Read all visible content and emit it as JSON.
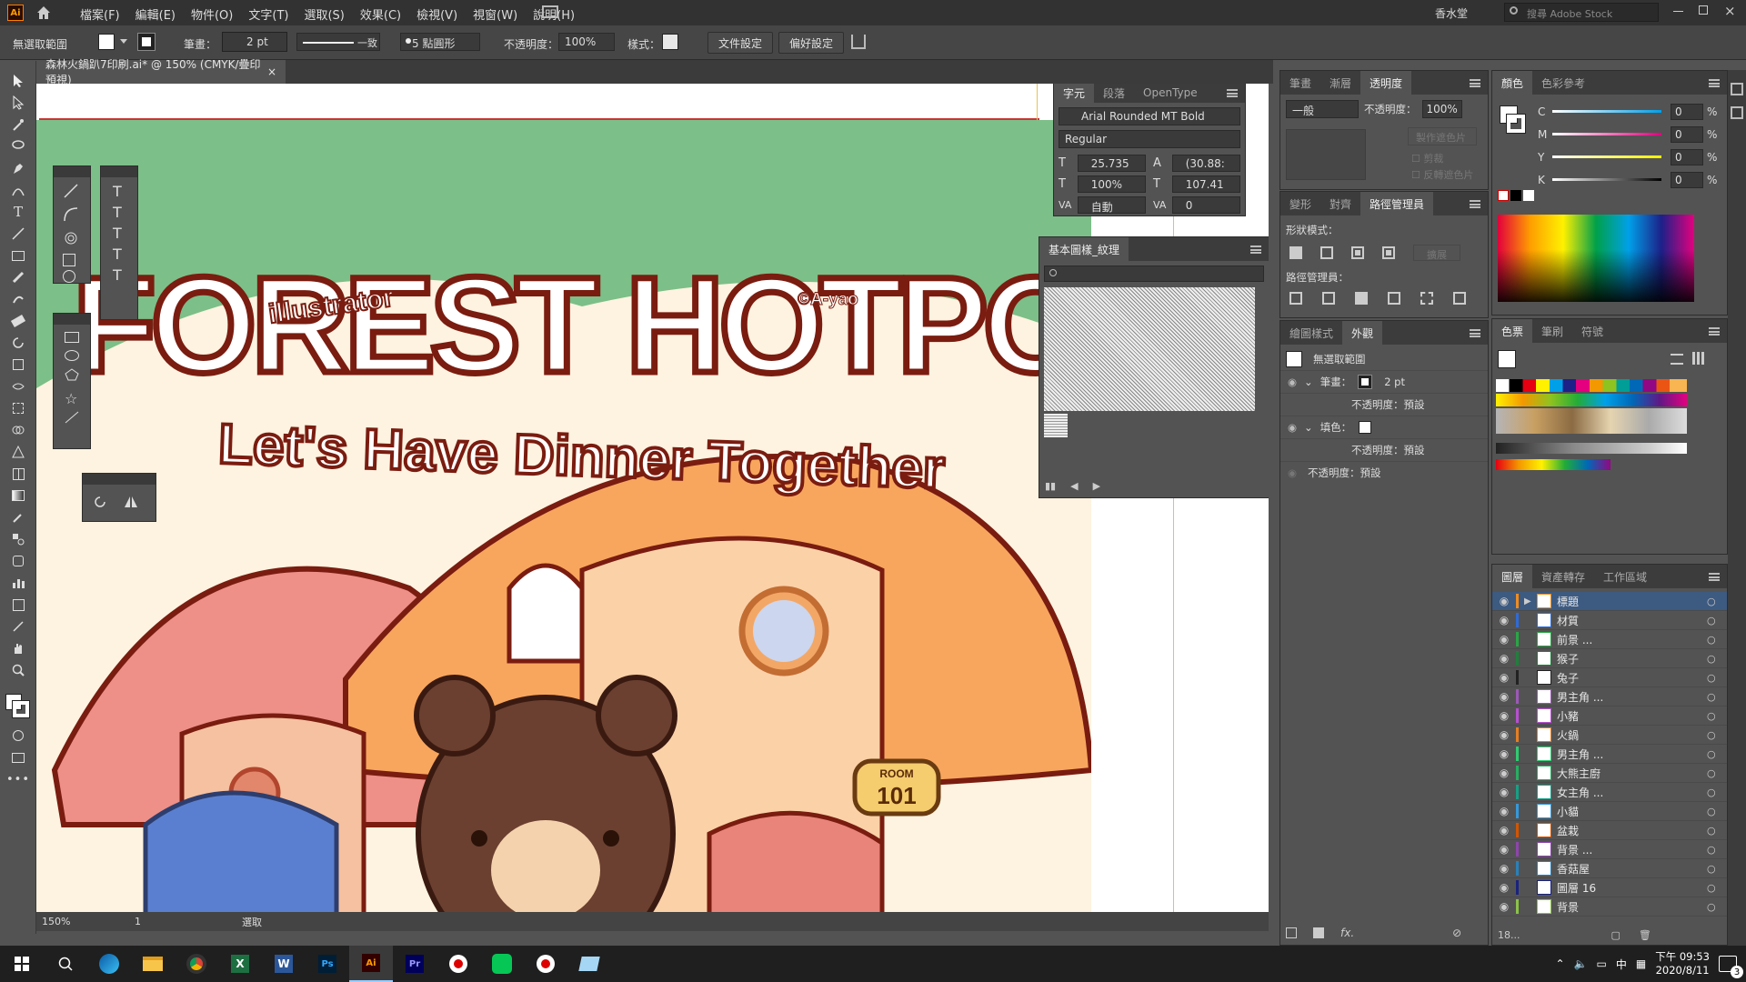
{
  "app": {
    "logo_text": "Ai"
  },
  "menus": [
    "檔案(F)",
    "編輯(E)",
    "物件(O)",
    "文字(T)",
    "選取(S)",
    "效果(C)",
    "檢視(V)",
    "視窗(W)",
    "說明(H)"
  ],
  "workspace": "香水堂",
  "stock_search": {
    "placeholder": "搜尋 Adobe Stock"
  },
  "control": {
    "selection_label": "無選取範圍",
    "stroke_label": "筆畫：",
    "stroke_value": "2 pt",
    "profile_label": "一致",
    "brush_label": "5 點圓形",
    "opacity_label": "不透明度：",
    "opacity_value": "100%",
    "style_label": "樣式：",
    "doc_setup_btn": "文件設定",
    "prefs_btn": "偏好設定"
  },
  "document_tab": {
    "title": "森林火鍋趴7印刷.ai* @ 150% (CMYK/疊印預視)"
  },
  "artwork": {
    "title_line": "FOREST HOTPOT",
    "subtitle": "Let's Have Dinner Together",
    "tag_illustrator": "illustrator",
    "credit": "©A-yao",
    "sign_room": "ROOM",
    "sign_number": "101"
  },
  "character_panel": {
    "tabs": [
      "字元",
      "段落",
      "OpenType"
    ],
    "font_family": "Arial Rounded MT Bold",
    "font_style": "Regular",
    "font_size": "25.735",
    "leading": "(30.88:",
    "vert_scale": "100%",
    "horiz_scale": "107.41",
    "kerning": "自動",
    "tracking": "0"
  },
  "swatch_lib_panel": {
    "title": "基本圖樣_紋理"
  },
  "transparency_panel": {
    "tabs": [
      "筆畫",
      "漸層",
      "透明度"
    ],
    "mode": "一般",
    "opacity_label": "不透明度：",
    "opacity_value": "100%",
    "make_mask_btn": "製作遮色片",
    "clip_label": "剪裁",
    "invert_label": "反轉遮色片"
  },
  "pathfinder_panel": {
    "tabs": [
      "變形",
      "對齊",
      "路徑管理員"
    ],
    "shape_modes_label": "形狀模式：",
    "expand_btn": "擴展",
    "pathfinders_label": "路徑管理員："
  },
  "appearance_panel": {
    "tabs": [
      "繪圖樣式",
      "外觀"
    ],
    "header": "無選取範圍",
    "stroke_label": "筆畫：",
    "stroke_value": "2 pt",
    "opacity_default_1": "不透明度：預設",
    "fill_label": "填色：",
    "opacity_default_2": "不透明度：預設",
    "opacity_default_3": "不透明度：預設"
  },
  "color_panel": {
    "tabs": [
      "顏色",
      "色彩參考"
    ],
    "channels": [
      {
        "name": "C",
        "value": "0",
        "unit": "%"
      },
      {
        "name": "M",
        "value": "0",
        "unit": "%"
      },
      {
        "name": "Y",
        "value": "0",
        "unit": "%"
      },
      {
        "name": "K",
        "value": "0",
        "unit": "%"
      }
    ]
  },
  "swatches_panel": {
    "tabs": [
      "色票",
      "筆刷",
      "符號"
    ]
  },
  "layers_panel": {
    "tabs": [
      "圖層",
      "資產轉存",
      "工作區域"
    ],
    "layers": [
      {
        "name": "標題",
        "color": "#f08c1e"
      },
      {
        "name": "材質",
        "color": "#2f6bd6"
      },
      {
        "name": "前景 ...",
        "color": "#28a745"
      },
      {
        "name": "猴子",
        "color": "#1f7f3a"
      },
      {
        "name": "兔子",
        "color": "#222222"
      },
      {
        "name": "男主角 ...",
        "color": "#9b59b6"
      },
      {
        "name": "小豬",
        "color": "#b84fd0"
      },
      {
        "name": "火鍋",
        "color": "#e67e22"
      },
      {
        "name": "男主角 ...",
        "color": "#2ecc71"
      },
      {
        "name": "大熊主廚",
        "color": "#27ae60"
      },
      {
        "name": "女主角 ...",
        "color": "#16a085"
      },
      {
        "name": "小貓",
        "color": "#3498db"
      },
      {
        "name": "盆栽",
        "color": "#d35400"
      },
      {
        "name": "背景 ...",
        "color": "#8e44ad"
      },
      {
        "name": "香菇屋",
        "color": "#2980b9"
      },
      {
        "name": "圖層 16",
        "color": "#1a237e"
      },
      {
        "name": "背景",
        "color": "#8bc34a"
      }
    ],
    "count": "18..."
  },
  "status_bar": {
    "zoom": "150%",
    "artboard": "1",
    "tool": "選取"
  },
  "taskbar": {
    "time": "下午 09:53",
    "date": "2020/8/11",
    "ime": "中",
    "notif_count": "3"
  }
}
